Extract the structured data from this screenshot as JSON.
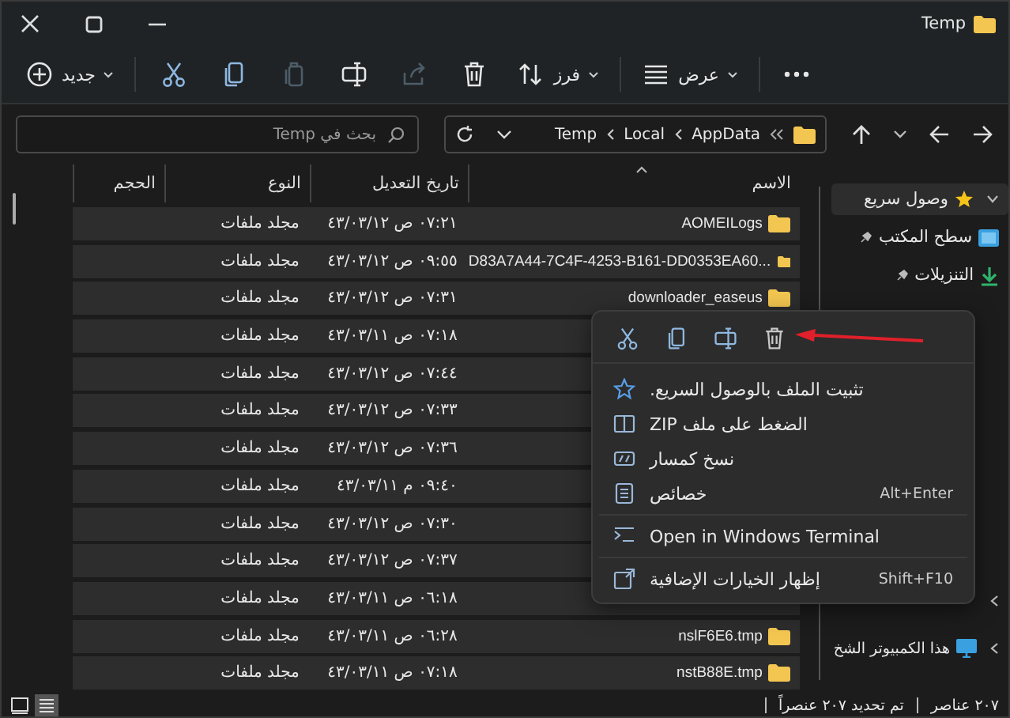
{
  "window": {
    "title": "Temp"
  },
  "toolbar": {
    "actions": [
      {
        "kind": "more",
        "disabled": false
      },
      {
        "kind": "view",
        "label": "عرض",
        "disabled": false
      },
      {
        "kind": "sort",
        "label": "فرز",
        "disabled": false
      },
      {
        "kind": "delete",
        "disabled": false
      },
      {
        "kind": "share",
        "disabled": true
      },
      {
        "kind": "rename",
        "disabled": false
      },
      {
        "kind": "paste",
        "disabled": true
      },
      {
        "kind": "copy",
        "disabled": false
      },
      {
        "kind": "cut",
        "disabled": false
      },
      {
        "kind": "new",
        "label": "جديد",
        "disabled": false
      }
    ]
  },
  "address": {
    "path": [
      "AppData",
      "Local",
      "Temp"
    ]
  },
  "search": {
    "placeholder": "بحث في Temp"
  },
  "table": {
    "columns": [
      {
        "label": "الاسم",
        "sorted": true
      },
      {
        "label": "تاريخ التعديل",
        "sorted": false
      },
      {
        "label": "النوع",
        "sorted": false
      },
      {
        "label": "الحجم",
        "sorted": false
      }
    ],
    "rows": [
      {
        "name": "AOMEILogs",
        "modified": "٠٧:٢١ ص ٤٣/٠٣/١٢",
        "type": "مجلد ملفات",
        "selected": true
      },
      {
        "name": "D83A7A44-7C4F-4253-B161-DD0353EA60...",
        "modified": "٠٩:٥٥ ص ٤٣/٠٣/١٢",
        "type": "مجلد ملفات",
        "selected": true
      },
      {
        "name": "downloader_easeus",
        "modified": "٠٧:٣١ ص ٤٣/٠٣/١٢",
        "type": "مجلد ملفات",
        "selected": true
      },
      {
        "modified": "٠٧:١٨ ص ٤٣/٠٣/١١",
        "type": "مجلد ملفات",
        "selected": true
      },
      {
        "modified": "٠٧:٤٤ ص ٤٣/٠٣/١٢",
        "type": "مجلد ملفات",
        "selected": true
      },
      {
        "modified": "٠٧:٣٣ ص ٤٣/٠٣/١٢",
        "type": "مجلد ملفات",
        "selected": true
      },
      {
        "modified": "٠٧:٣٦ ص ٤٣/٠٣/١٢",
        "type": "مجلد ملفات",
        "selected": true
      },
      {
        "modified": "٠٩:٤٠ م ٤٣/٠٣/١١",
        "type": "مجلد ملفات",
        "selected": true
      },
      {
        "modified": "٠٧:٣٠ ص ٤٣/٠٣/١٢",
        "type": "مجلد ملفات",
        "selected": true
      },
      {
        "modified": "٠٧:٣٧ ص ٤٣/٠٣/١٢",
        "type": "مجلد ملفات",
        "selected": true
      },
      {
        "modified": "٠٦:١٨ ص ٤٣/٠٣/١١",
        "type": "مجلد ملفات",
        "selected": true
      },
      {
        "name": "nslF6E6.tmp",
        "modified": "٠٦:٢٨ ص ٤٣/٠٣/١١",
        "type": "مجلد ملفات",
        "selected": true
      },
      {
        "name": "nstB88E.tmp",
        "modified": "٠٧:١٨ ص ٤٣/٠٣/١١",
        "type": "مجلد ملفات",
        "selected": true
      }
    ]
  },
  "sidebar": {
    "top_items": [
      {
        "label": "وصول سريع",
        "kind": "star",
        "expandable": true,
        "pinned": false,
        "selected": true
      },
      {
        "label": "سطح المكتب",
        "kind": "desktop",
        "expandable": false,
        "pinned": true,
        "selected": false
      },
      {
        "label": "التنزيلات",
        "kind": "download",
        "expandable": false,
        "pinned": true,
        "selected": false
      }
    ],
    "lower_items": [
      {
        "kind": "none",
        "expandable": true,
        "selected": false
      },
      {
        "label": "هذا الكمبيوتر الشخ",
        "kind": "monitor",
        "expandable": true,
        "selected": false
      }
    ]
  },
  "context_menu": {
    "quick_actions": [
      {
        "kind": "cut"
      },
      {
        "kind": "copy"
      },
      {
        "kind": "rename"
      },
      {
        "kind": "delete"
      }
    ],
    "groups": [
      [
        {
          "kind": "star",
          "label": "تثبيت الملف بالوصول السريع."
        },
        {
          "kind": "zip",
          "label": "الضغط على ملف ZIP"
        },
        {
          "kind": "path",
          "label": "نسخ كمسار"
        },
        {
          "kind": "properties",
          "label": "خصائص",
          "shortcut": "Alt+Enter"
        }
      ],
      [
        {
          "kind": "terminal",
          "label": "Open in Windows Terminal"
        }
      ],
      [
        {
          "kind": "more",
          "label": "إظهار الخيارات الإضافية",
          "shortcut": "Shift+F10"
        }
      ]
    ]
  },
  "status_bar": {
    "item_count": "٢٠٧ عناصر",
    "selection": "تم تحديد ٢٠٧ عنصراً"
  },
  "view_modes": [
    {
      "kind": "tiles",
      "selected": false
    },
    {
      "kind": "details",
      "selected": true
    }
  ]
}
